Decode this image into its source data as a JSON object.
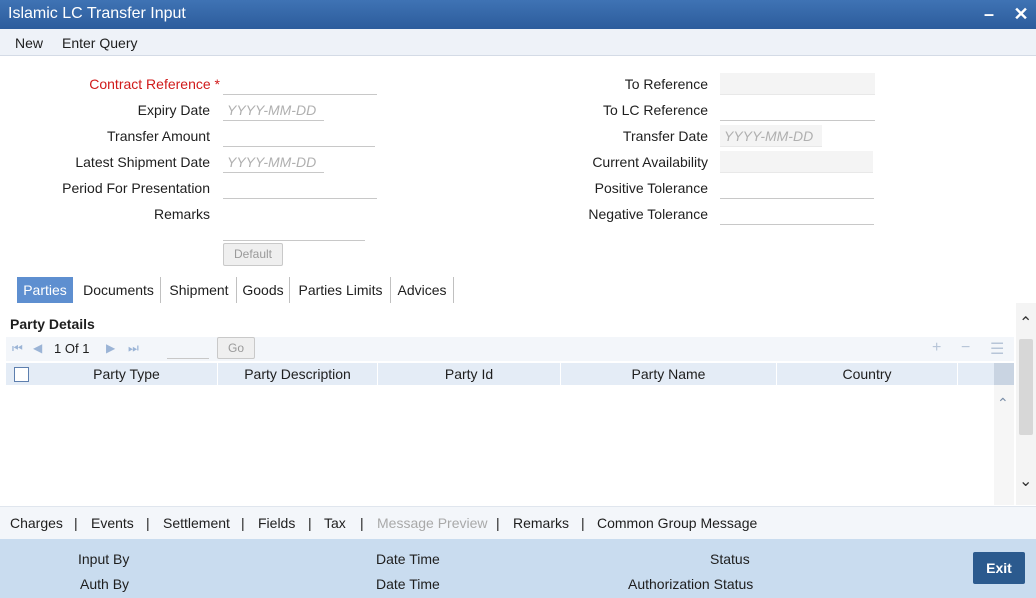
{
  "window": {
    "title": "Islamic LC Transfer Input",
    "minimize_glyph": "–",
    "close_glyph": "✕"
  },
  "menu": {
    "new": "New",
    "enter_query": "Enter Query"
  },
  "form": {
    "contract_reference": {
      "label": "Contract Reference",
      "required_mark": "*",
      "value": ""
    },
    "expiry_date": {
      "label": "Expiry Date",
      "placeholder": "YYYY-MM-DD"
    },
    "transfer_amount": {
      "label": "Transfer Amount",
      "value": ""
    },
    "latest_shipment_date": {
      "label": "Latest Shipment Date",
      "placeholder": "YYYY-MM-DD"
    },
    "period_for_presentation": {
      "label": "Period For Presentation",
      "value": ""
    },
    "remarks": {
      "label": "Remarks",
      "value": ""
    },
    "default_button": "Default",
    "to_reference": {
      "label": "To Reference",
      "value": ""
    },
    "to_lc_reference": {
      "label": "To LC Reference",
      "value": ""
    },
    "transfer_date": {
      "label": "Transfer Date",
      "placeholder": "YYYY-MM-DD"
    },
    "current_availability": {
      "label": "Current Availability",
      "value": ""
    },
    "positive_tolerance": {
      "label": "Positive Tolerance",
      "value": ""
    },
    "negative_tolerance": {
      "label": "Negative Tolerance",
      "value": ""
    }
  },
  "tabs": [
    "Parties",
    "Documents",
    "Shipment",
    "Goods",
    "Parties Limits",
    "Advices"
  ],
  "active_tab": "Parties",
  "party_details": {
    "title": "Party Details",
    "pagination": {
      "current": "1",
      "of_label": "Of",
      "total": "1"
    },
    "go_button": "Go",
    "columns": [
      "Party Type",
      "Party Description",
      "Party Id",
      "Party Name",
      "Country"
    ],
    "rows": []
  },
  "bottom_links": {
    "charges": "Charges",
    "events": "Events",
    "settlement": "Settlement",
    "fields": "Fields",
    "tax": "Tax",
    "message_preview": "Message Preview",
    "remarks": "Remarks",
    "common_group_message": "Common Group Message",
    "separator": "|"
  },
  "footer": {
    "input_by": "Input By",
    "auth_by": "Auth By",
    "date_time_1": "Date Time",
    "date_time_2": "Date Time",
    "status": "Status",
    "authorization_status": "Authorization Status",
    "exit_button": "Exit"
  },
  "colors": {
    "title_bar": "#2f62a6",
    "active_tab": "#5e8fd0",
    "required_label": "#d01a1a",
    "footer_bg": "#c9dcef",
    "exit_button": "#2b5a8e"
  }
}
